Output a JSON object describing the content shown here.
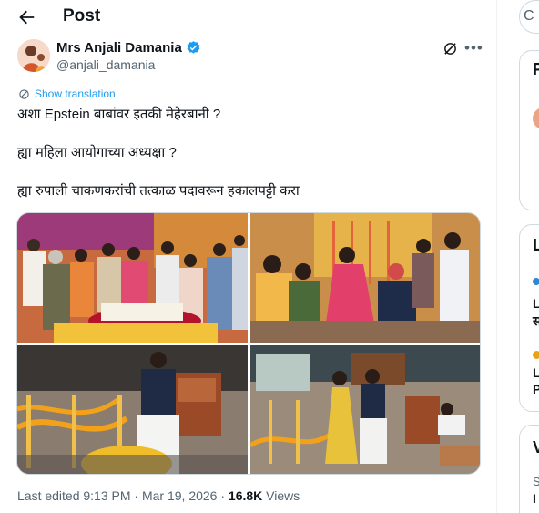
{
  "header": {
    "title": "Post"
  },
  "author": {
    "name": "Mrs Anjali Damania",
    "handle": "@anjali_damania"
  },
  "translate_label": "Show translation",
  "post_lines": [
    "अशा Epstein बाबांवर इतकी मेहेरबानी ?",
    "ह्या महिला आयोगाच्या अध्यक्षा ?",
    "ह्या रुपाली चाकणकरांची  तत्काळ पदावरून हकालपट्टी करा"
  ],
  "meta": {
    "edited": "Last edited 9:13 PM · Mar 19, 2026 · ",
    "views_count": "16.8K",
    "views_label": " Views"
  },
  "sidebar": {
    "search_glyph": "C",
    "card1_letter": "F",
    "card2_letter": "L",
    "card2_row1": "L",
    "card2_row1b": "स",
    "card2_row2": "L",
    "card2_row2b": "P",
    "card3_letter": "V",
    "card3_row1": "S",
    "card3_row2": "I"
  },
  "colors": {
    "accent": "#1d9bf0",
    "secondary_text": "#536471",
    "border": "#cfd9de"
  },
  "icons": [
    "back-arrow-icon",
    "verified-badge-icon",
    "grok-icon",
    "more-icon",
    "translate-icon"
  ]
}
